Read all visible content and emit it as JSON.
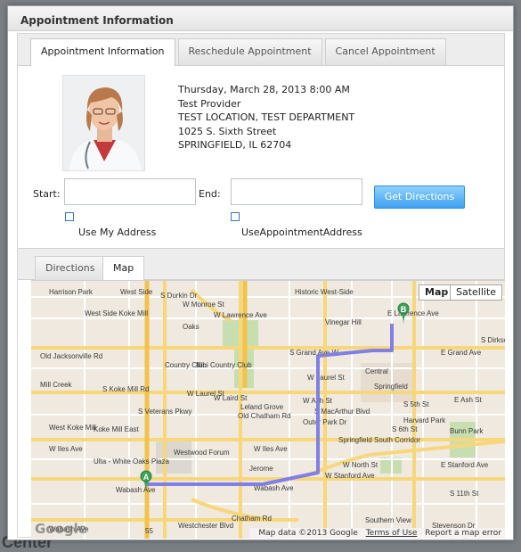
{
  "backdrop": {
    "text": "Center"
  },
  "dialog": {
    "title": "Appointment Information"
  },
  "tabs": [
    {
      "label": "Appointment Information"
    },
    {
      "label": "Reschedule Appointment"
    },
    {
      "label": "Cancel Appointment"
    }
  ],
  "appointment": {
    "datetime": "Thursday, March 28, 2013 8:00 AM",
    "provider": "Test Provider",
    "location": "TEST LOCATION, TEST DEPARTMENT",
    "street": "1025 S. Sixth Street",
    "city": "SPRINGFIELD, IL 62704"
  },
  "directions_form": {
    "start_label": "Start:",
    "start_value": "",
    "end_label": "End:",
    "end_value": "",
    "button_label": "Get Directions",
    "use_my_address_label": "Use My Address",
    "use_appointment_address_label": "UseAppointmentAddress"
  },
  "subtabs": [
    {
      "label": "Directions"
    },
    {
      "label": "Map"
    }
  ],
  "map": {
    "type_map_label": "Map",
    "type_satellite_label": "Satellite",
    "marker_a": "A",
    "marker_b": "B",
    "attribution": "Map data ©2013 Google",
    "terms_label": "Terms of Use",
    "report_label": "Report a map error",
    "logo_text": "Google",
    "route_color": "#7f7fe6",
    "labels": [
      "Harrison Park",
      "West Side",
      "West Side Koke Mill",
      "Oaks",
      "Vinegar Hill",
      "W Lawrence Ave",
      "E Lawrence Ave",
      "Old Jacksonville Rd",
      "Country Club",
      "Illini Country Club",
      "S Grand Ave W",
      "E Grand Ave",
      "Mill Creek",
      "W Laurel St",
      "Central",
      "Springfield",
      "W Ash St",
      "E Ash St",
      "W Laurel St",
      "Leland Grove",
      "Outer Park Dr",
      "E Stanford Ave",
      "West Koke Mill",
      "Koke Mill East",
      "Harvard Park",
      "Bunn Park",
      "W Iles Ave",
      "Westwood Forum",
      "W Iles Ave",
      "Springfield South Corridor",
      "Ulta - White Oaks Plaza",
      "Jerome",
      "Wabash Ave",
      "Wabash Ave",
      "W Stanford Ave",
      "W North St",
      "Wabash Ave",
      "Westchester Blvd",
      "Southern View",
      "Stevenson Dr",
      "W Monroe St",
      "S Koke Mill Rd",
      "S Veterans Pkwy",
      "S Durkin Dr",
      "Chatham Rd",
      "S MacArthur Blvd",
      "S 5th St",
      "S 11th St",
      "S 6th St",
      "Iles Park",
      "S Dirksen Pkwy",
      "Old Chatham Rd",
      "W Laird St",
      "Historic West-Side",
      "55"
    ]
  }
}
